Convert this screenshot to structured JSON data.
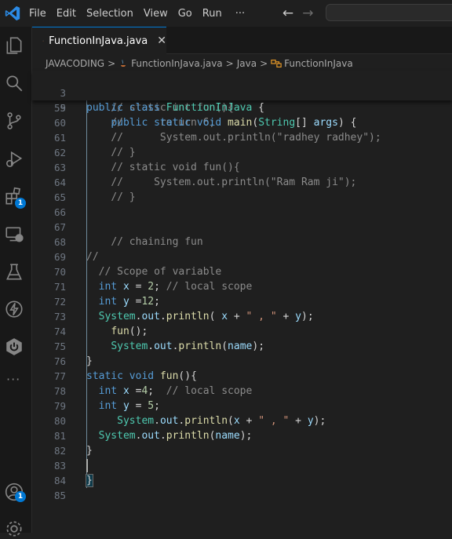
{
  "menu": {
    "file": "File",
    "edit": "Edit",
    "selection": "Selection",
    "view": "View",
    "go": "Go",
    "run": "Run",
    "more": "···"
  },
  "nav": {
    "back": "←",
    "forward": "→"
  },
  "activity": {
    "extensions_badge": "1",
    "accounts_badge": "1",
    "more": "···"
  },
  "tab": {
    "label": "FunctionInJava.java",
    "close": "✕"
  },
  "breadcrumb": {
    "root": "JAVACODING",
    "file": "FunctionInJava.java",
    "sep": ">",
    "symbol1": "Java",
    "symbol2": "FunctionInJava"
  },
  "sticky": [
    {
      "n": "3",
      "code": "public class FunctionInJava {"
    },
    {
      "n": "5",
      "code": "    public static void main(String[] args) {"
    }
  ],
  "lines": [
    {
      "n": "59",
      "code": "    // static int fun(){"
    },
    {
      "n": "60",
      "code": "    //      return 6;"
    },
    {
      "n": "61",
      "code": "    //      System.out.println(\"radhey radhey\");"
    },
    {
      "n": "62",
      "code": "    // }"
    },
    {
      "n": "63",
      "code": "    // static void fun(){"
    },
    {
      "n": "64",
      "code": "    //     System.out.println(\"Ram Ram ji\");"
    },
    {
      "n": "65",
      "code": "    // }"
    },
    {
      "n": "66",
      "code": ""
    },
    {
      "n": "67",
      "code": ""
    },
    {
      "n": "68",
      "code": "    // chaining fun"
    },
    {
      "n": "69",
      "code": "//"
    },
    {
      "n": "70",
      "code": "  // Scope of variable"
    },
    {
      "n": "71",
      "code": "  int x = 2; // local scope"
    },
    {
      "n": "72",
      "code": "  int y =12;"
    },
    {
      "n": "73",
      "code": "  System.out.println( x + \" , \" + y);"
    },
    {
      "n": "74",
      "code": "    fun();"
    },
    {
      "n": "75",
      "code": "    System.out.println(name);"
    },
    {
      "n": "76",
      "code": "}"
    },
    {
      "n": "77",
      "code": "static void fun(){"
    },
    {
      "n": "78",
      "code": "  int x =4;  // local scope"
    },
    {
      "n": "79",
      "code": "  int y = 5;"
    },
    {
      "n": "80",
      "code": "     System.out.println(x + \" , \" + y);"
    },
    {
      "n": "81",
      "code": "  System.out.println(name);"
    },
    {
      "n": "82",
      "code": "}"
    },
    {
      "n": "83",
      "code": ""
    },
    {
      "n": "84",
      "code": "}"
    },
    {
      "n": "85",
      "code": ""
    }
  ],
  "colors": {
    "accent": "#0078d4",
    "keyword": "#569cd6",
    "type": "#4ec9b0",
    "function": "#dcdcaa",
    "variable": "#9cdcfe",
    "number": "#b5cea8",
    "string": "#ce9178",
    "comment": "#6a9955"
  }
}
